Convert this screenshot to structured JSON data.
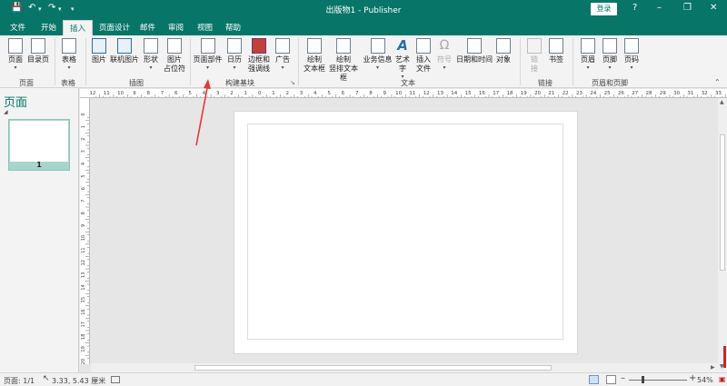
{
  "window": {
    "title": "出版物1 - Publisher",
    "login_label": "登录",
    "help_glyph": "?"
  },
  "tabs": [
    "文件",
    "开始",
    "插入",
    "页面设计",
    "邮件",
    "审阅",
    "视图",
    "帮助"
  ],
  "active_tab": "插入",
  "ribbon": {
    "pages": {
      "page": "页面",
      "catalog": "目录页",
      "group": "页面"
    },
    "tables": {
      "table": "表格",
      "group": "表格"
    },
    "illustrations": {
      "picture": "图片",
      "online_picture": "联机图片",
      "shapes": "形状",
      "placeholder_1": "图片",
      "placeholder_2": "占位符",
      "group": "插图"
    },
    "building_blocks": {
      "page_parts": "页面部件",
      "calendar": "日历",
      "borders_1": "边框和",
      "borders_2": "强调线",
      "ads": "广告",
      "group": "构建基块"
    },
    "text": {
      "draw_textbox_1": "绘制",
      "draw_textbox_2": "文本框",
      "draw_vtextbox_1": "绘制",
      "draw_vtextbox_2": "竖排文本框",
      "business_info": "业务信息",
      "wordart": "艺术字",
      "insert_file_1": "插入",
      "insert_file_2": "文件",
      "symbol": "符号",
      "datetime": "日期和时间",
      "object": "对象",
      "group": "文本"
    },
    "links": {
      "link": "链接",
      "bookmark": "书签",
      "group": "链接"
    },
    "header_footer": {
      "header": "页眉",
      "footer": "页脚",
      "page_number": "页码",
      "group": "页眉和页脚"
    }
  },
  "pages_pane": {
    "title": "页面",
    "thumbnails": [
      {
        "number": "1"
      }
    ]
  },
  "status": {
    "page": "页面: 1/1",
    "position": "3.33, 5.43 厘米",
    "zoom": "54%"
  },
  "ruler": {
    "h_labels": [
      "12",
      "11",
      "10",
      "9",
      "8",
      "7",
      "6",
      "5",
      "4",
      "3",
      "2",
      "1",
      "0",
      "1",
      "2",
      "3",
      "4",
      "5",
      "6",
      "7",
      "8",
      "9",
      "10",
      "11",
      "12",
      "13",
      "14",
      "15",
      "16",
      "17",
      "18",
      "19",
      "20",
      "21",
      "22",
      "23",
      "24",
      "25",
      "26",
      "27",
      "28",
      "29",
      "30",
      "31",
      "32",
      "33",
      "34"
    ],
    "v_labels": [
      "0",
      "1",
      "2",
      "3",
      "4",
      "5",
      "6",
      "7",
      "8",
      "9",
      "10",
      "11",
      "12",
      "13",
      "14",
      "15",
      "16",
      "17",
      "18",
      "19",
      "20"
    ]
  },
  "colors": {
    "accent": "#077568",
    "annotation_arrow": "#e53935"
  }
}
